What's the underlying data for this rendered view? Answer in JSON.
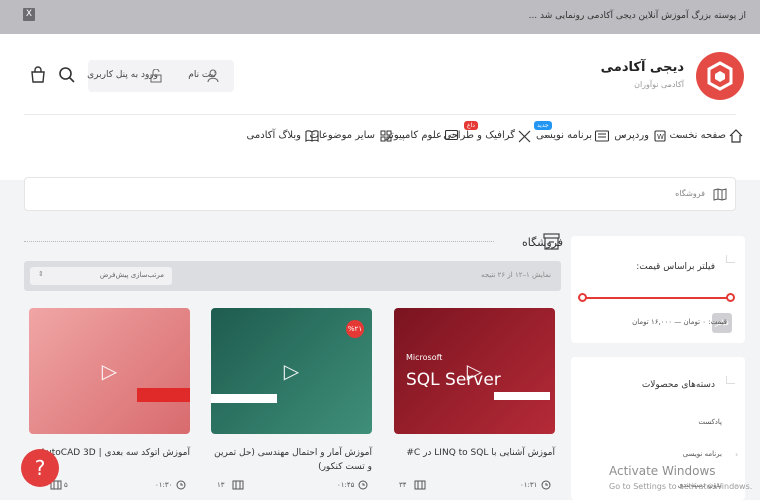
{
  "topbar": {
    "announcement": "از پوسته بزرگ آموزش آنلاین دیجی آکادمی رونمایی شد ...",
    "close_label": "X"
  },
  "brand": {
    "title": "دیجی آکادمی",
    "subtitle": "آکادمی نوآوران",
    "accent": "#e44b44"
  },
  "header": {
    "register_label": "ثبت نام",
    "login_label": "ورود به پنل کاربری",
    "cart_count": "۰"
  },
  "nav": {
    "items": [
      {
        "label": "صفحه نخست"
      },
      {
        "label": "وردپرس"
      },
      {
        "label": "برنامه نویسی",
        "badge": "جدید"
      },
      {
        "label": "گرافیک و طراحی",
        "badge": "داغ"
      },
      {
        "label": "علوم کامپیوتر"
      },
      {
        "label": "سایر موضوعات"
      },
      {
        "label": "وبلاگ آکادمی"
      }
    ]
  },
  "breadcrumb": {
    "current": "فروشگاه"
  },
  "sidebar": {
    "price_filter": {
      "title": "فیلتر براساس قیمت:",
      "button_label": "فیلتر",
      "price_label": "قیمت: ۰ تومان — ۱۶,۰۰۰ تومان",
      "range": [
        0,
        16000
      ]
    },
    "categories": {
      "title": "دسته‌های محصولات",
      "items": [
        "پادکست",
        "برنامه نویسی",
        "بدون دسته‌بندی"
      ]
    }
  },
  "shop": {
    "title": "فروشگاه",
    "result_count": "نمایش ۱–۱۲ از ۲۶ نتیجه",
    "sort_label": "مرتب‌سازی پیش‌فرض"
  },
  "products": [
    {
      "title": "آموزش آشنایی با LINQ to SQL در C#",
      "image_text": "SQL Server",
      "image_brand": "Microsoft",
      "time": "۰۱:۳۱",
      "lessons": "۳۴",
      "img_color": "#9d1f2c"
    },
    {
      "title": "آموزش آمار و احتمال مهندسی (حل تمرین و تست کنکور)",
      "time": "۰۱:۴۵",
      "lessons": "۱۳",
      "img_badge": "%۲۱",
      "img_color": "#2d6a5a"
    },
    {
      "title": "آموزش اتوکد سه بعدی | AutoCAD 3D",
      "time": "۰۱:۳۰",
      "lessons": "۵",
      "img_color": "#e58c8e"
    }
  ],
  "help": {
    "icon": "question-icon",
    "label": "?"
  },
  "watermark": {
    "title": "Activate Windows",
    "sub": "Go to Settings to activate Windows."
  }
}
